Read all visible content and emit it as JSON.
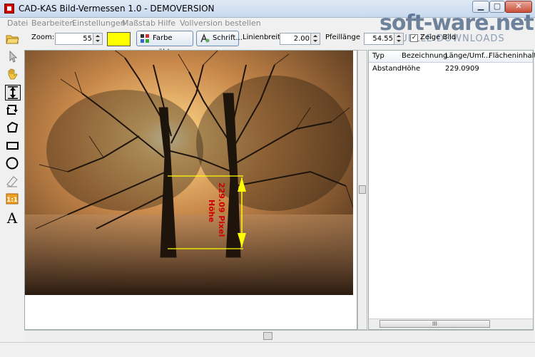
{
  "window": {
    "title": "CAD-KAS Bild-Vermessen 1.0 - DEMOVERSION"
  },
  "menu": [
    "Datei",
    "Bearbeiten",
    "Einstellungen",
    "Maßstab",
    "Hilfe",
    "Vollversion bestellen"
  ],
  "toolbar": {
    "zoom_label": "Zoom:",
    "zoom_value": "55",
    "color_button": "Farbe wählen",
    "font_button": "Schrift...",
    "linewidth_label": "Linienbreite:",
    "linewidth_value": "2.00",
    "arrow_label": "Pfeillänge",
    "arrow_value": "54.55",
    "show_image_label": "Zeige Bild",
    "show_image_checked": true,
    "color_value": "#ffff00"
  },
  "tools": [
    "open-folder-icon",
    "pointer-icon",
    "hand-icon",
    "measure-icon",
    "rotate-icon",
    "polygon-icon",
    "rectangle-icon",
    "circle-icon",
    "eraser-icon",
    "scale-icon",
    "text-icon"
  ],
  "measurement": {
    "label": "229.09 Pixel",
    "sub": "Höhe",
    "color": "#ffff00",
    "text_color": "#cc0000"
  },
  "list": {
    "headers": [
      "Typ",
      "Bezeichnung",
      "Länge/Umf...",
      "Flächeninhalt"
    ],
    "rows": [
      {
        "typ": "Abstand",
        "bez": "Höhe",
        "len": "229.0909",
        "area": ""
      }
    ],
    "scroll_grip": "III"
  },
  "watermark": {
    "text": "soft-ware.net",
    "sub": "AKTUELLE DOWNLOADS"
  }
}
